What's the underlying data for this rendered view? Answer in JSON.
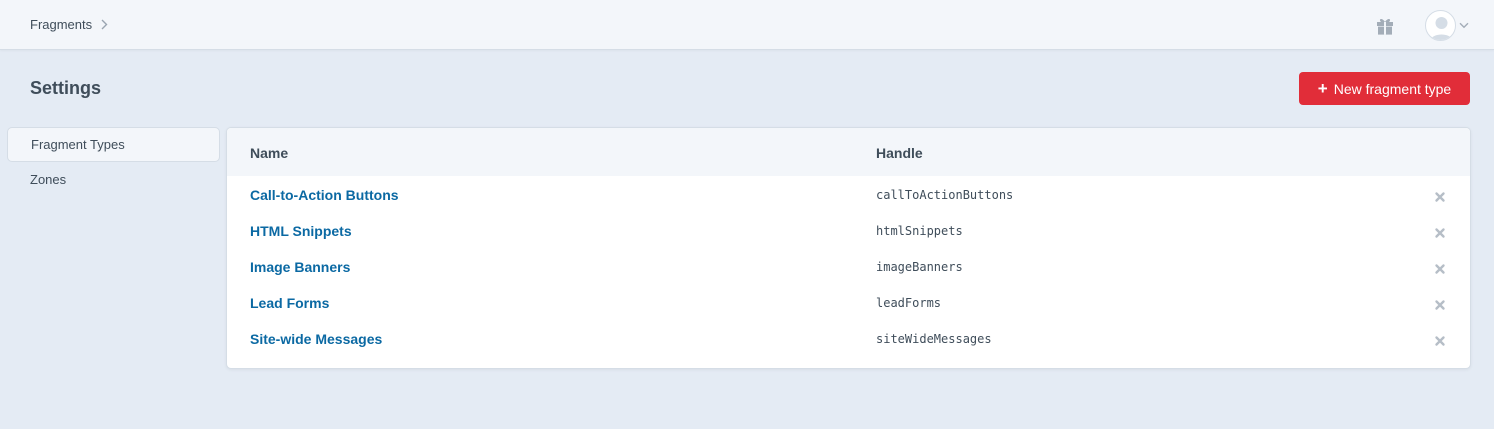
{
  "header": {
    "breadcrumb": "Fragments"
  },
  "page": {
    "title": "Settings",
    "new_button_label": "New fragment type"
  },
  "sidebar": {
    "items": [
      {
        "label": "Fragment Types",
        "active": true
      },
      {
        "label": "Zones",
        "active": false
      }
    ]
  },
  "table": {
    "columns": [
      "Name",
      "Handle"
    ],
    "rows": [
      {
        "name": "Call-to-Action Buttons",
        "handle": "callToActionButtons"
      },
      {
        "name": "HTML Snippets",
        "handle": "htmlSnippets"
      },
      {
        "name": "Image Banners",
        "handle": "imageBanners"
      },
      {
        "name": "Lead Forms",
        "handle": "leadForms"
      },
      {
        "name": "Site-wide Messages",
        "handle": "siteWideMessages"
      }
    ]
  },
  "icons": {
    "breadcrumb_separator": "chevron-right-icon",
    "gift": "gift-icon",
    "avatar": "user-avatar-icon",
    "account_menu": "chevron-down-icon",
    "new_button": "plus-icon",
    "row_action": "delete-icon"
  },
  "colors": {
    "accent": "#e12d39",
    "link": "#0b69a3",
    "background": "#e4ebf4",
    "header": "#f3f6fa"
  }
}
